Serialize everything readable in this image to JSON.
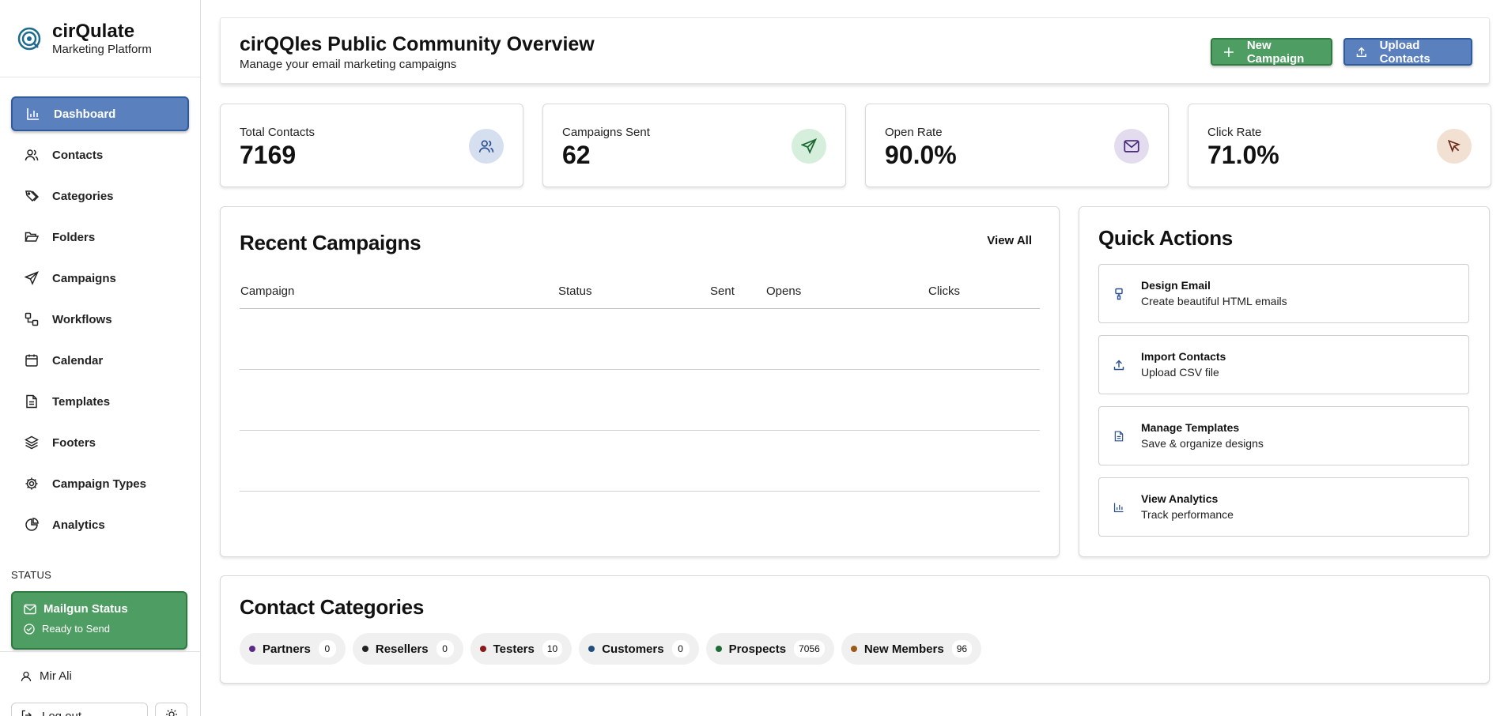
{
  "brand": {
    "name": "cirQulate",
    "subtitle": "Marketing Platform"
  },
  "sidebar": {
    "items": [
      {
        "label": "Dashboard",
        "icon": "bar-chart-icon",
        "active": true
      },
      {
        "label": "Contacts",
        "icon": "users-icon"
      },
      {
        "label": "Categories",
        "icon": "tags-icon"
      },
      {
        "label": "Folders",
        "icon": "folder-open-icon"
      },
      {
        "label": "Campaigns",
        "icon": "send-icon"
      },
      {
        "label": "Workflows",
        "icon": "workflow-icon"
      },
      {
        "label": "Calendar",
        "icon": "calendar-icon"
      },
      {
        "label": "Templates",
        "icon": "file-text-icon"
      },
      {
        "label": "Footers",
        "icon": "layers-icon"
      },
      {
        "label": "Campaign Types",
        "icon": "gear-icon"
      },
      {
        "label": "Analytics",
        "icon": "pie-chart-icon"
      }
    ],
    "status_label": "STATUS",
    "status_title": "Mailgun Status",
    "status_text": "Ready to Send",
    "user_name": "Mir Ali",
    "logout_label": "Log out"
  },
  "header": {
    "title": "cirQQles Public Community Overview",
    "subtitle": "Manage your email marketing campaigns",
    "new_campaign_label": "New Campaign",
    "upload_contacts_label": "Upload Contacts"
  },
  "stats": [
    {
      "label": "Total Contacts",
      "value": "7169",
      "icon": "users-icon",
      "icon_bg": "#d5dff0",
      "icon_color": "#2a4f8f"
    },
    {
      "label": "Campaigns Sent",
      "value": "62",
      "icon": "send-icon",
      "icon_bg": "#d6efdc",
      "icon_color": "#1f6b36"
    },
    {
      "label": "Open Rate",
      "value": "90.0%",
      "icon": "mail-icon",
      "icon_bg": "#e3dcef",
      "icon_color": "#4a2a7a"
    },
    {
      "label": "Click Rate",
      "value": "71.0%",
      "icon": "cursor-icon",
      "icon_bg": "#f2e0d2",
      "icon_color": "#6b2a1a"
    }
  ],
  "recent": {
    "title": "Recent Campaigns",
    "view_all": "View All",
    "columns": [
      "Campaign",
      "Status",
      "Sent",
      "Opens",
      "Clicks"
    ]
  },
  "quick_actions": {
    "title": "Quick Actions",
    "items": [
      {
        "title": "Design Email",
        "subtitle": "Create beautiful HTML emails",
        "icon": "brush-icon"
      },
      {
        "title": "Import Contacts",
        "subtitle": "Upload CSV file",
        "icon": "upload-icon"
      },
      {
        "title": "Manage Templates",
        "subtitle": "Save & organize designs",
        "icon": "file-text-icon"
      },
      {
        "title": "View Analytics",
        "subtitle": "Track performance",
        "icon": "bar-chart-icon"
      }
    ]
  },
  "categories": {
    "title": "Contact Categories",
    "items": [
      {
        "label": "Partners",
        "count": "0",
        "color": "#5b2a86"
      },
      {
        "label": "Resellers",
        "count": "0",
        "color": "#222222"
      },
      {
        "label": "Testers",
        "count": "10",
        "color": "#8a1a1a"
      },
      {
        "label": "Customers",
        "count": "0",
        "color": "#1f4f7a"
      },
      {
        "label": "Prospects",
        "count": "7056",
        "color": "#1f6b36"
      },
      {
        "label": "New Members",
        "count": "96",
        "color": "#9a5a1a"
      }
    ]
  }
}
